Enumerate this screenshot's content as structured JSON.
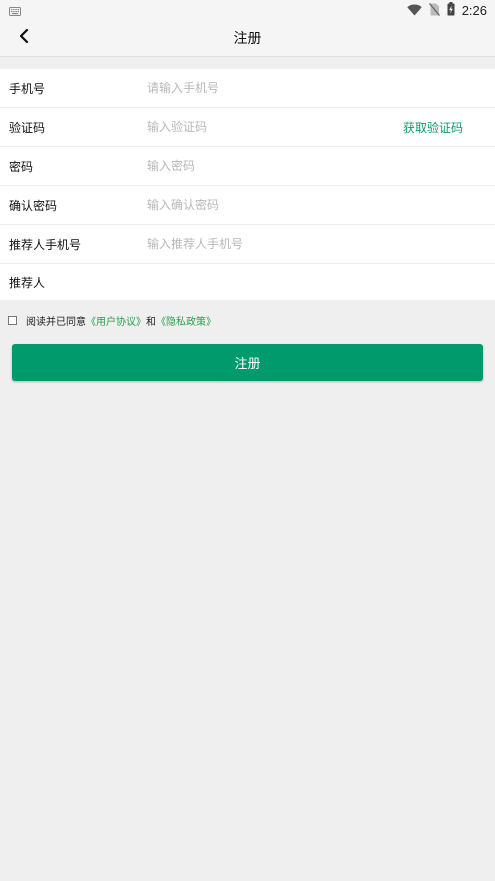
{
  "status_bar": {
    "time": "2:26",
    "icons": [
      "keyboard-icon",
      "wifi-icon",
      "no-sim-icon",
      "battery-charging-icon"
    ]
  },
  "header": {
    "title": "注册",
    "back_icon": "chevron-left-icon"
  },
  "form": {
    "phone": {
      "label": "手机号",
      "placeholder": "请输入手机号"
    },
    "code": {
      "label": "验证码",
      "placeholder": "输入验证码",
      "action": "获取验证码"
    },
    "password": {
      "label": "密码",
      "placeholder": "输入密码"
    },
    "confirm_password": {
      "label": "确认密码",
      "placeholder": "输入确认密码"
    },
    "referrer_phone": {
      "label": "推荐人手机号",
      "placeholder": "输入推荐人手机号"
    },
    "referrer": {
      "label": "推荐人",
      "placeholder": ""
    }
  },
  "agreement": {
    "prefix": "阅读并已同意",
    "user_agreement": "《用户协议》",
    "conjunction": "和",
    "privacy_policy": "《隐私政策》",
    "checked": false
  },
  "submit_label": "注册",
  "colors": {
    "accent": "#009a6c",
    "link_green": "#2aa04a",
    "background": "#efefef"
  }
}
